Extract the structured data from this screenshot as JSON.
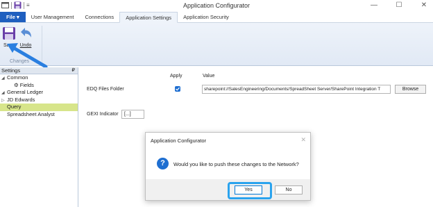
{
  "window": {
    "title": "Application Configurator",
    "controls": [
      "—",
      "☐",
      "✕"
    ]
  },
  "tabs": [
    {
      "label": "File ▾",
      "kind": "file"
    },
    {
      "label": "User Management",
      "kind": "normal"
    },
    {
      "label": "Connections",
      "kind": "normal"
    },
    {
      "label": "Application Settings",
      "kind": "active"
    },
    {
      "label": "Application Security",
      "kind": "normal"
    }
  ],
  "ribbon": {
    "save_label": "Save",
    "undo_label": "Undo",
    "group_label": "Changes"
  },
  "settings_panel": {
    "header": "Settings",
    "pin": "₽",
    "items": [
      {
        "label": "Common",
        "twisty": "◢",
        "level": 0,
        "selected": false
      },
      {
        "label": "⚙ Fields",
        "twisty": "",
        "level": 1,
        "selected": false
      },
      {
        "label": "General Ledger",
        "twisty": "◢",
        "level": 0,
        "selected": false
      },
      {
        "label": "JD Edwards",
        "twisty": "▷",
        "level": 0,
        "selected": false
      },
      {
        "label": "Query",
        "twisty": "",
        "level": 0,
        "selected": true
      },
      {
        "label": "Spreadsheet Analyst",
        "twisty": "",
        "level": 0,
        "selected": false
      }
    ]
  },
  "main": {
    "col_apply": "Apply",
    "col_value": "Value",
    "edq_label": "EDQ Files Folder",
    "edq_apply_checked": true,
    "edq_value": "sharepoint://SalesEngineering/Documents/SpreadSheet Server/SharePoint Integration T",
    "browse_label": "Browse",
    "gexi_label": "GEXI Indicator",
    "gexi_button": "[...]"
  },
  "dialog": {
    "title": "Application Configurator",
    "close": "✕",
    "icon": "?",
    "message": "Would you like to push these changes to the Network?",
    "yes_label": "Yes",
    "no_label": "No"
  },
  "colors": {
    "accent": "#1f6fd1",
    "file_tab": "#1f5fbf",
    "selected_row": "#d7e58a",
    "highlight": "#2aa3ee"
  }
}
